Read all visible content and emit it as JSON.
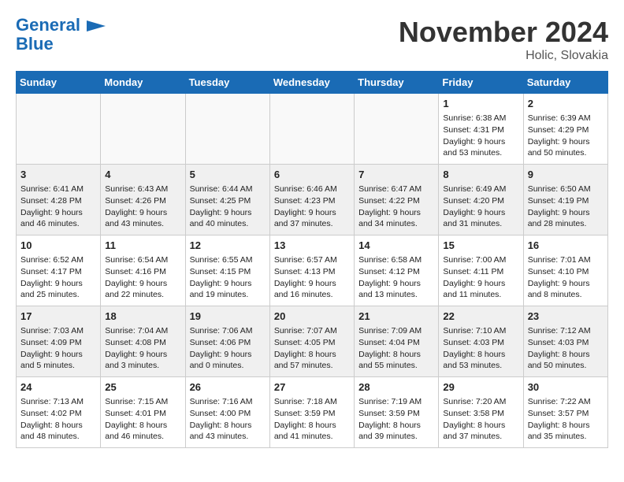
{
  "header": {
    "logo_line1": "General",
    "logo_line2": "Blue",
    "month_title": "November 2024",
    "location": "Holic, Slovakia"
  },
  "weekdays": [
    "Sunday",
    "Monday",
    "Tuesday",
    "Wednesday",
    "Thursday",
    "Friday",
    "Saturday"
  ],
  "weeks": [
    [
      {
        "day": "",
        "info": ""
      },
      {
        "day": "",
        "info": ""
      },
      {
        "day": "",
        "info": ""
      },
      {
        "day": "",
        "info": ""
      },
      {
        "day": "",
        "info": ""
      },
      {
        "day": "1",
        "info": "Sunrise: 6:38 AM\nSunset: 4:31 PM\nDaylight: 9 hours\nand 53 minutes."
      },
      {
        "day": "2",
        "info": "Sunrise: 6:39 AM\nSunset: 4:29 PM\nDaylight: 9 hours\nand 50 minutes."
      }
    ],
    [
      {
        "day": "3",
        "info": "Sunrise: 6:41 AM\nSunset: 4:28 PM\nDaylight: 9 hours\nand 46 minutes."
      },
      {
        "day": "4",
        "info": "Sunrise: 6:43 AM\nSunset: 4:26 PM\nDaylight: 9 hours\nand 43 minutes."
      },
      {
        "day": "5",
        "info": "Sunrise: 6:44 AM\nSunset: 4:25 PM\nDaylight: 9 hours\nand 40 minutes."
      },
      {
        "day": "6",
        "info": "Sunrise: 6:46 AM\nSunset: 4:23 PM\nDaylight: 9 hours\nand 37 minutes."
      },
      {
        "day": "7",
        "info": "Sunrise: 6:47 AM\nSunset: 4:22 PM\nDaylight: 9 hours\nand 34 minutes."
      },
      {
        "day": "8",
        "info": "Sunrise: 6:49 AM\nSunset: 4:20 PM\nDaylight: 9 hours\nand 31 minutes."
      },
      {
        "day": "9",
        "info": "Sunrise: 6:50 AM\nSunset: 4:19 PM\nDaylight: 9 hours\nand 28 minutes."
      }
    ],
    [
      {
        "day": "10",
        "info": "Sunrise: 6:52 AM\nSunset: 4:17 PM\nDaylight: 9 hours\nand 25 minutes."
      },
      {
        "day": "11",
        "info": "Sunrise: 6:54 AM\nSunset: 4:16 PM\nDaylight: 9 hours\nand 22 minutes."
      },
      {
        "day": "12",
        "info": "Sunrise: 6:55 AM\nSunset: 4:15 PM\nDaylight: 9 hours\nand 19 minutes."
      },
      {
        "day": "13",
        "info": "Sunrise: 6:57 AM\nSunset: 4:13 PM\nDaylight: 9 hours\nand 16 minutes."
      },
      {
        "day": "14",
        "info": "Sunrise: 6:58 AM\nSunset: 4:12 PM\nDaylight: 9 hours\nand 13 minutes."
      },
      {
        "day": "15",
        "info": "Sunrise: 7:00 AM\nSunset: 4:11 PM\nDaylight: 9 hours\nand 11 minutes."
      },
      {
        "day": "16",
        "info": "Sunrise: 7:01 AM\nSunset: 4:10 PM\nDaylight: 9 hours\nand 8 minutes."
      }
    ],
    [
      {
        "day": "17",
        "info": "Sunrise: 7:03 AM\nSunset: 4:09 PM\nDaylight: 9 hours\nand 5 minutes."
      },
      {
        "day": "18",
        "info": "Sunrise: 7:04 AM\nSunset: 4:08 PM\nDaylight: 9 hours\nand 3 minutes."
      },
      {
        "day": "19",
        "info": "Sunrise: 7:06 AM\nSunset: 4:06 PM\nDaylight: 9 hours\nand 0 minutes."
      },
      {
        "day": "20",
        "info": "Sunrise: 7:07 AM\nSunset: 4:05 PM\nDaylight: 8 hours\nand 57 minutes."
      },
      {
        "day": "21",
        "info": "Sunrise: 7:09 AM\nSunset: 4:04 PM\nDaylight: 8 hours\nand 55 minutes."
      },
      {
        "day": "22",
        "info": "Sunrise: 7:10 AM\nSunset: 4:03 PM\nDaylight: 8 hours\nand 53 minutes."
      },
      {
        "day": "23",
        "info": "Sunrise: 7:12 AM\nSunset: 4:03 PM\nDaylight: 8 hours\nand 50 minutes."
      }
    ],
    [
      {
        "day": "24",
        "info": "Sunrise: 7:13 AM\nSunset: 4:02 PM\nDaylight: 8 hours\nand 48 minutes."
      },
      {
        "day": "25",
        "info": "Sunrise: 7:15 AM\nSunset: 4:01 PM\nDaylight: 8 hours\nand 46 minutes."
      },
      {
        "day": "26",
        "info": "Sunrise: 7:16 AM\nSunset: 4:00 PM\nDaylight: 8 hours\nand 43 minutes."
      },
      {
        "day": "27",
        "info": "Sunrise: 7:18 AM\nSunset: 3:59 PM\nDaylight: 8 hours\nand 41 minutes."
      },
      {
        "day": "28",
        "info": "Sunrise: 7:19 AM\nSunset: 3:59 PM\nDaylight: 8 hours\nand 39 minutes."
      },
      {
        "day": "29",
        "info": "Sunrise: 7:20 AM\nSunset: 3:58 PM\nDaylight: 8 hours\nand 37 minutes."
      },
      {
        "day": "30",
        "info": "Sunrise: 7:22 AM\nSunset: 3:57 PM\nDaylight: 8 hours\nand 35 minutes."
      }
    ]
  ]
}
